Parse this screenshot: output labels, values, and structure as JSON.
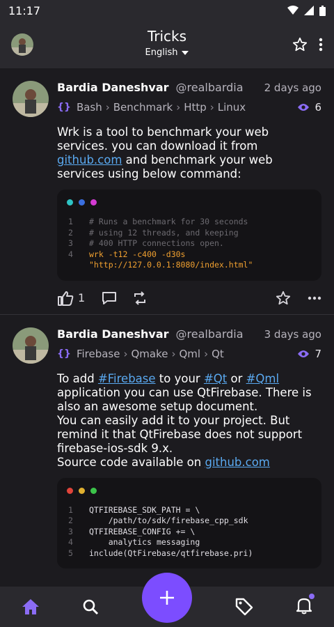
{
  "status_bar": {
    "time": "11:17"
  },
  "app_bar": {
    "title": "Tricks",
    "language": "English"
  },
  "posts": [
    {
      "author": "Bardia Daneshvar",
      "handle": "@realbardia",
      "time": "2 days ago",
      "tags": [
        "Bash",
        "Benchmark",
        "Http",
        "Linux"
      ],
      "views": "6",
      "body": {
        "t1": "Wrk is a tool to benchmark your web services. you can download it from ",
        "link": "github.com",
        "t2": " and benchmark your web services using below command:"
      },
      "code": [
        {
          "n": "1",
          "text": "# Runs a benchmark for 30 seconds",
          "color": "#6c6a70"
        },
        {
          "n": "2",
          "text": "# using 12 threads, and keeping",
          "color": "#6c6a70"
        },
        {
          "n": "3",
          "text": "# 400 HTTP connections open.",
          "color": "#6c6a70"
        },
        {
          "n": "4",
          "text": "wrk -t12 -c400 -d30s \"http://127.0.0.1:8080/index.html\"",
          "color": "#f0a030"
        }
      ],
      "likes": "1"
    },
    {
      "author": "Bardia Daneshvar",
      "handle": "@realbardia",
      "time": "3 days ago",
      "tags": [
        "Firebase",
        "Qmake",
        "Qml",
        "Qt"
      ],
      "views": "7",
      "body": {
        "t1": "To add ",
        "h1": "#Firebase",
        "t2": " to your ",
        "h2": "#Qt",
        "t3": " or ",
        "h3": "#Qml",
        "t4": " application you can use QtFirebase. There is also an awesome setup document.",
        "t5": "You can easily add it to your project. But remind it that QtFirebase does not support firebase-ios-sdk 9.x.",
        "t6": "Source code available on ",
        "link": "github.com"
      },
      "code": [
        {
          "n": "1",
          "text": "QTFIREBASE_SDK_PATH = \\",
          "color": "#e0dee4"
        },
        {
          "n": "2",
          "text": "    /path/to/sdk/firebase_cpp_sdk",
          "color": "#e0dee4"
        },
        {
          "n": "3",
          "text": "QTFIREBASE_CONFIG += \\",
          "color": "#e0dee4"
        },
        {
          "n": "4",
          "text": "    analytics messaging",
          "color": "#e0dee4"
        },
        {
          "n": "5",
          "text": "include(QtFirebase/qtfirebase.pri)",
          "color": "#e0dee4"
        }
      ]
    }
  ],
  "colors": {
    "accent": "#7c4dff",
    "link": "#5aa9f0",
    "tag_icon": "#8b6cf5"
  },
  "nav": {
    "items": [
      "home-icon",
      "search-icon",
      "add-icon",
      "tag-icon",
      "bell-icon"
    ]
  }
}
